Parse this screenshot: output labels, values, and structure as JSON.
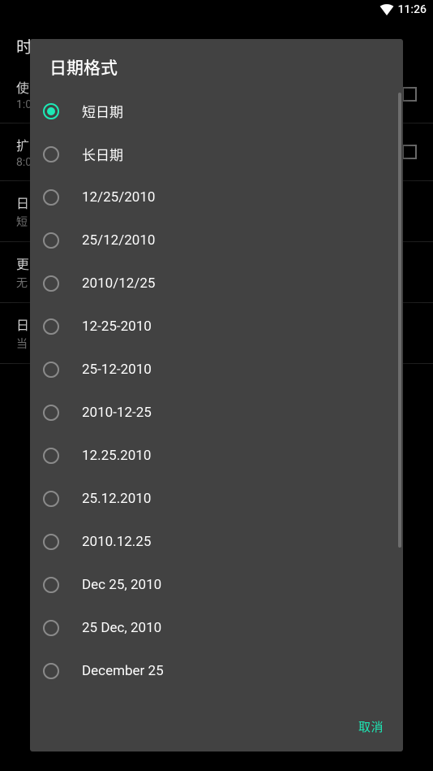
{
  "status": {
    "time": "11:26"
  },
  "background": {
    "title": "时",
    "items": [
      {
        "primary": "使",
        "secondary": "1:0",
        "checkbox": true
      },
      {
        "primary": "扩",
        "secondary": "8:0",
        "checkbox": true
      },
      {
        "primary": "日",
        "secondary": "短",
        "checkbox": false
      },
      {
        "primary": "更",
        "secondary": "无",
        "checkbox": false
      },
      {
        "primary": "日",
        "secondary": "当",
        "checkbox": false
      }
    ]
  },
  "dialog": {
    "title": "日期格式",
    "options": [
      {
        "label": "短日期",
        "selected": true
      },
      {
        "label": "长日期",
        "selected": false
      },
      {
        "label": "12/25/2010",
        "selected": false
      },
      {
        "label": "25/12/2010",
        "selected": false
      },
      {
        "label": "2010/12/25",
        "selected": false
      },
      {
        "label": "12-25-2010",
        "selected": false
      },
      {
        "label": "25-12-2010",
        "selected": false
      },
      {
        "label": "2010-12-25",
        "selected": false
      },
      {
        "label": "12.25.2010",
        "selected": false
      },
      {
        "label": "25.12.2010",
        "selected": false
      },
      {
        "label": "2010.12.25",
        "selected": false
      },
      {
        "label": "Dec 25, 2010",
        "selected": false
      },
      {
        "label": "25 Dec, 2010",
        "selected": false
      },
      {
        "label": "December 25",
        "selected": false
      }
    ],
    "cancel": "取消"
  },
  "colors": {
    "accent": "#1de9b6",
    "dialog_bg": "#424242"
  }
}
